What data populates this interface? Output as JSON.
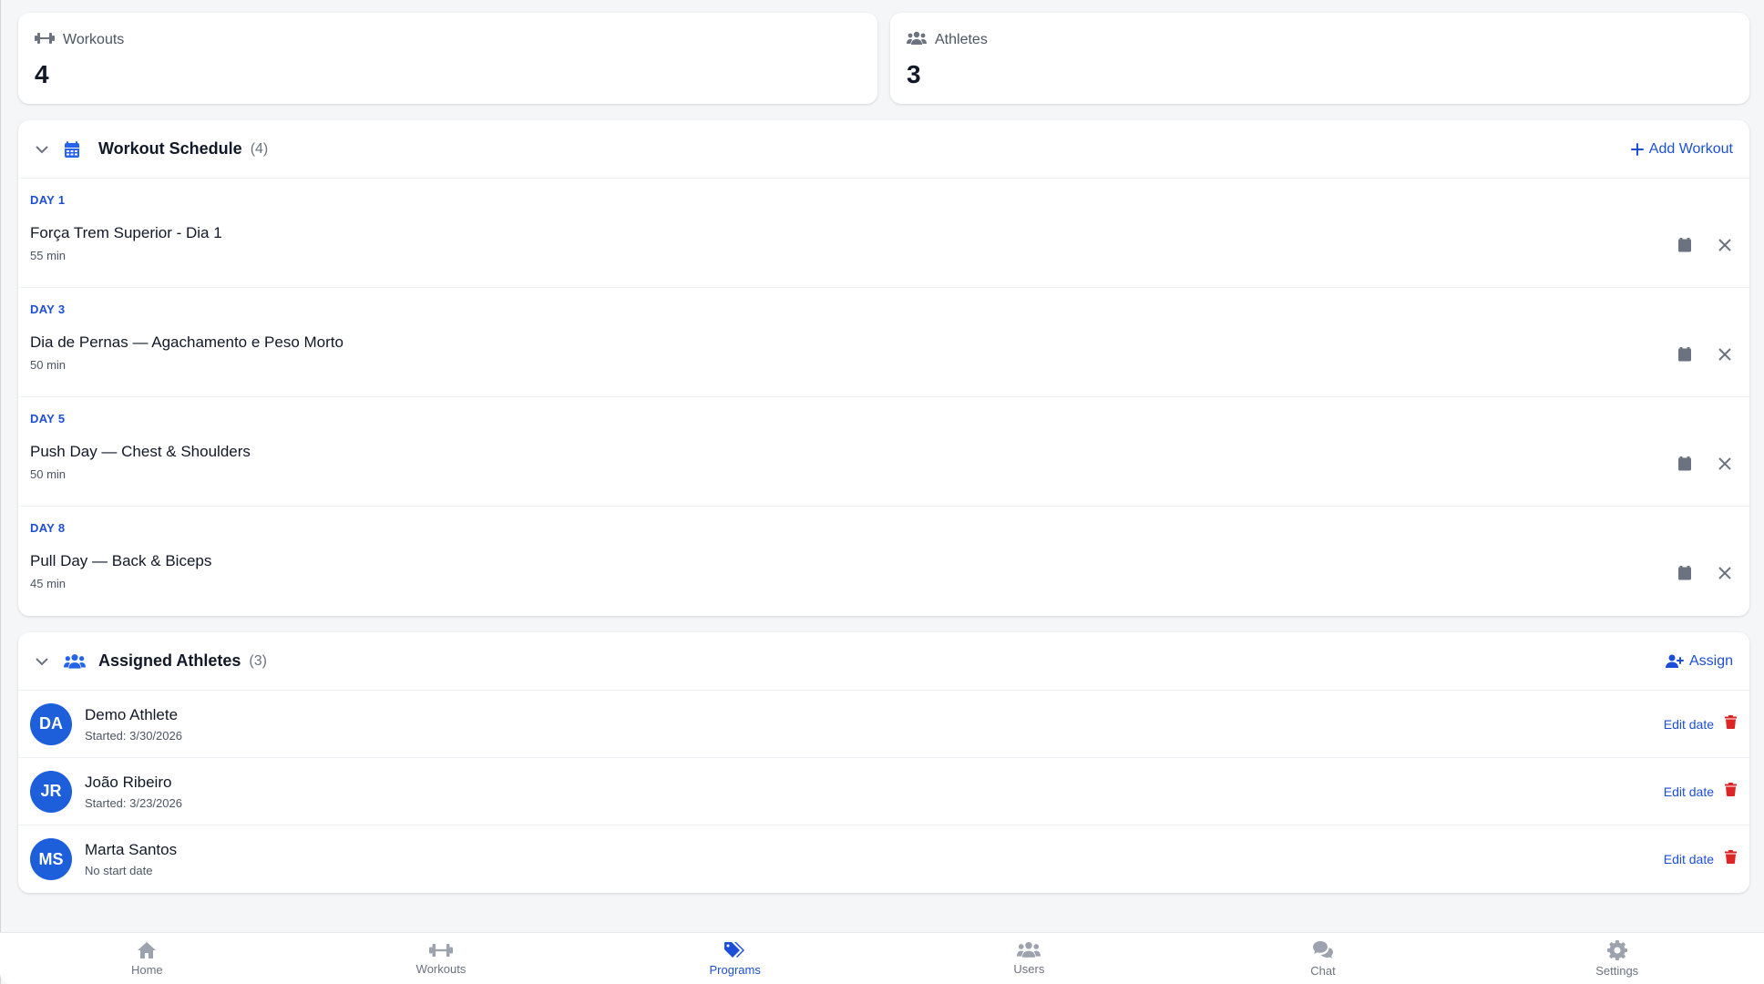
{
  "stats": {
    "workouts": {
      "label": "Workouts",
      "value": "4",
      "icon": "dumbbell-icon"
    },
    "athletes": {
      "label": "Athletes",
      "value": "3",
      "icon": "users-icon"
    }
  },
  "schedule": {
    "title": "Workout Schedule",
    "count": "(4)",
    "action_label": "Add Workout",
    "items": [
      {
        "day": "DAY 1",
        "name": "Força Trem Superior - Dia 1",
        "duration": "55 min"
      },
      {
        "day": "DAY 3",
        "name": "Dia de Pernas — Agachamento e Peso Morto",
        "duration": "50 min"
      },
      {
        "day": "DAY 5",
        "name": "Push Day — Chest & Shoulders",
        "duration": "50 min"
      },
      {
        "day": "DAY 8",
        "name": "Pull Day — Back & Biceps",
        "duration": "45 min"
      }
    ]
  },
  "athletes": {
    "title": "Assigned Athletes",
    "count": "(3)",
    "action_label": "Assign",
    "edit_label": "Edit date",
    "items": [
      {
        "initials": "DA",
        "name": "Demo Athlete",
        "sub": "Started: 3/30/2026"
      },
      {
        "initials": "JR",
        "name": "João Ribeiro",
        "sub": "Started: 3/23/2026"
      },
      {
        "initials": "MS",
        "name": "Marta Santos",
        "sub": "No start date"
      }
    ]
  },
  "nav": {
    "items": [
      {
        "label": "Home",
        "icon": "home-icon"
      },
      {
        "label": "Workouts",
        "icon": "dumbbell-icon"
      },
      {
        "label": "Programs",
        "icon": "tags-icon",
        "active": true
      },
      {
        "label": "Users",
        "icon": "users-icon"
      },
      {
        "label": "Chat",
        "icon": "chat-icon"
      },
      {
        "label": "Settings",
        "icon": "gear-icon"
      }
    ]
  },
  "colors": {
    "accent": "#1d4ed8",
    "danger": "#dc2626",
    "avatar": "#1d5fdb"
  }
}
